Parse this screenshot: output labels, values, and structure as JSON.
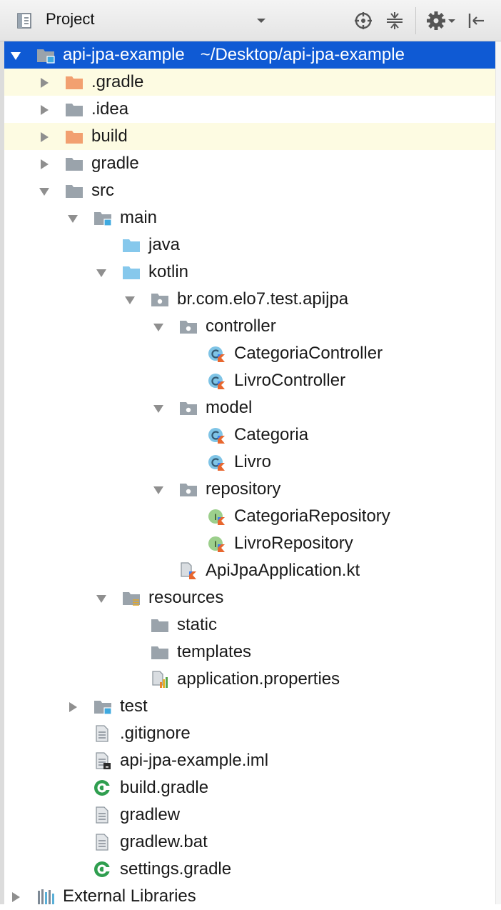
{
  "toolbar": {
    "title": "Project",
    "view_icon": "project-view-icon",
    "dropdown_icon": "chevron-down-icon",
    "buttons": [
      "locate-icon",
      "collapse-all-icon",
      "gear-icon",
      "hide-icon"
    ]
  },
  "colors": {
    "selection": "#0f5ad4",
    "excluded_row": "#fdfbe2",
    "folder_gray": "#9aa3ab",
    "folder_orange": "#f2a070",
    "folder_blue": "#86c8ec",
    "class_icon": "#7fc4e6",
    "interface_icon": "#9ccf8c",
    "kotlin_accent": "#e8672e"
  },
  "tree": [
    {
      "depth": 0,
      "arrow": "down",
      "icon": "module-folder-icon",
      "label": "api-jpa-example",
      "path": "~/Desktop/api-jpa-example",
      "selected": true,
      "interactable": true
    },
    {
      "depth": 1,
      "arrow": "right",
      "icon": "orange-folder-icon",
      "label": ".gradle",
      "excluded": true
    },
    {
      "depth": 1,
      "arrow": "right",
      "icon": "gray-folder-icon",
      "label": ".idea"
    },
    {
      "depth": 1,
      "arrow": "right",
      "icon": "orange-folder-icon",
      "label": "build",
      "excluded": true
    },
    {
      "depth": 1,
      "arrow": "right",
      "icon": "gray-folder-icon",
      "label": "gradle"
    },
    {
      "depth": 1,
      "arrow": "down",
      "icon": "gray-folder-icon",
      "label": "src"
    },
    {
      "depth": 2,
      "arrow": "down",
      "icon": "module-folder-icon",
      "label": "main"
    },
    {
      "depth": 3,
      "arrow": "none",
      "icon": "blue-folder-icon",
      "label": "java"
    },
    {
      "depth": 3,
      "arrow": "down",
      "icon": "blue-folder-icon",
      "label": "kotlin"
    },
    {
      "depth": 4,
      "arrow": "down",
      "icon": "package-folder-icon",
      "label": "br.com.elo7.test.apijpa"
    },
    {
      "depth": 5,
      "arrow": "down",
      "icon": "package-folder-icon",
      "label": "controller"
    },
    {
      "depth": 6,
      "arrow": "none",
      "icon": "kotlin-class-icon",
      "label": "CategoriaController"
    },
    {
      "depth": 6,
      "arrow": "none",
      "icon": "kotlin-class-icon",
      "label": "LivroController"
    },
    {
      "depth": 5,
      "arrow": "down",
      "icon": "package-folder-icon",
      "label": "model"
    },
    {
      "depth": 6,
      "arrow": "none",
      "icon": "kotlin-class-icon",
      "label": "Categoria"
    },
    {
      "depth": 6,
      "arrow": "none",
      "icon": "kotlin-class-icon",
      "label": "Livro"
    },
    {
      "depth": 5,
      "arrow": "down",
      "icon": "package-folder-icon",
      "label": "repository"
    },
    {
      "depth": 6,
      "arrow": "none",
      "icon": "kotlin-interface-icon",
      "label": "CategoriaRepository"
    },
    {
      "depth": 6,
      "arrow": "none",
      "icon": "kotlin-interface-icon",
      "label": "LivroRepository"
    },
    {
      "depth": 5,
      "arrow": "none",
      "icon": "kotlin-file-icon",
      "label": "ApiJpaApplication.kt"
    },
    {
      "depth": 3,
      "arrow": "down",
      "icon": "resources-folder-icon",
      "label": "resources"
    },
    {
      "depth": 4,
      "arrow": "none",
      "icon": "gray-folder-icon",
      "label": "static"
    },
    {
      "depth": 4,
      "arrow": "none",
      "icon": "gray-folder-icon",
      "label": "templates"
    },
    {
      "depth": 4,
      "arrow": "none",
      "icon": "properties-file-icon",
      "label": "application.properties"
    },
    {
      "depth": 2,
      "arrow": "right",
      "icon": "module-folder-icon",
      "label": "test"
    },
    {
      "depth": 2,
      "arrow": "none",
      "icon": "text-file-icon",
      "label": ".gitignore"
    },
    {
      "depth": 2,
      "arrow": "none",
      "icon": "iml-file-icon",
      "label": "api-jpa-example.iml"
    },
    {
      "depth": 2,
      "arrow": "none",
      "icon": "gradle-file-icon",
      "label": "build.gradle"
    },
    {
      "depth": 2,
      "arrow": "none",
      "icon": "text-file-icon",
      "label": "gradlew"
    },
    {
      "depth": 2,
      "arrow": "none",
      "icon": "text-file-icon",
      "label": "gradlew.bat"
    },
    {
      "depth": 2,
      "arrow": "none",
      "icon": "gradle-file-icon",
      "label": "settings.gradle"
    },
    {
      "depth": 0,
      "arrow": "right",
      "icon": "libraries-icon",
      "label": "External Libraries"
    }
  ]
}
